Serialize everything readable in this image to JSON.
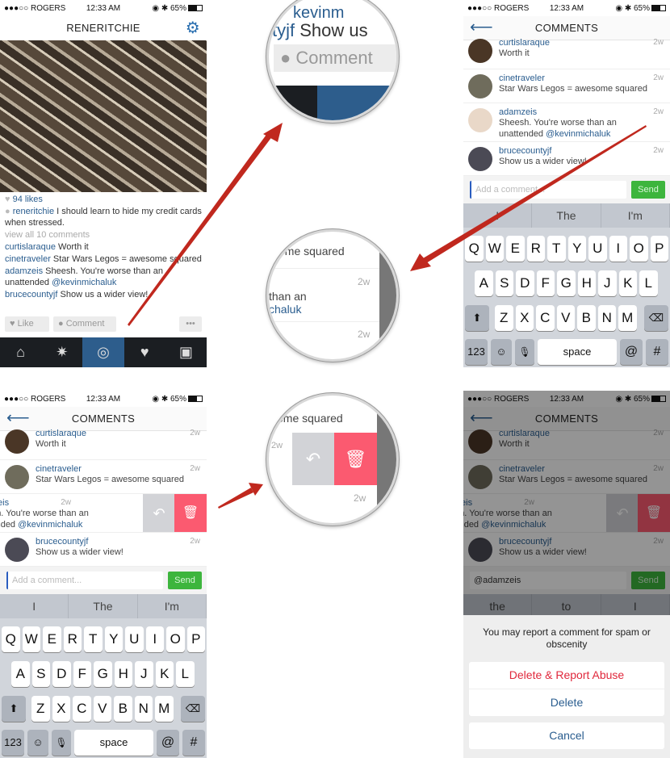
{
  "status": {
    "carrier": "●●●○○ ROGERS",
    "wifi": "≋",
    "time": "12:33 AM",
    "right": "◉ ✱ 65%"
  },
  "feed_screen": {
    "title": "RENERITCHIE",
    "likes": "94 likes",
    "caption_user": "reneritchie",
    "caption": "I should learn to hide my credit cards when stressed.",
    "view_all": "view all 10 comments",
    "comments": [
      {
        "user": "curtislaraque",
        "text": "Worth it"
      },
      {
        "user": "cinetraveler",
        "text": "Star Wars Legos = awesome squared"
      },
      {
        "user": "adamzeis",
        "text": "Sheesh. You're worse than an unattended",
        "mention": "@kevinmichaluk"
      },
      {
        "user": "brucecountyjf",
        "text": "Show us a wider view!"
      }
    ],
    "like_label": "Like",
    "comment_label": "Comment",
    "more_label": "•••"
  },
  "comments_screen": {
    "title": "COMMENTS",
    "items": [
      {
        "user": "curtislaraque",
        "text": "Worth it",
        "time": "2w"
      },
      {
        "user": "cinetraveler",
        "text": "Star Wars Legos = awesome squared",
        "time": "2w"
      },
      {
        "user": "adamzeis",
        "text": "Sheesh. You're worse than an unattended",
        "mention": "@kevinmichaluk",
        "time": "2w"
      },
      {
        "user": "brucecountyjf",
        "text": "Show us a wider view!",
        "time": "2w"
      }
    ],
    "placeholder": "Add a comment...",
    "send": "Send",
    "reply_value": "@adamzeis"
  },
  "keyboard": {
    "suggestions": [
      "I",
      "The",
      "I'm"
    ],
    "suggestions_alt": [
      "the",
      "to",
      "I"
    ],
    "row1": [
      "Q",
      "W",
      "E",
      "R",
      "T",
      "Y",
      "U",
      "I",
      "O",
      "P"
    ],
    "row2": [
      "A",
      "S",
      "D",
      "F",
      "G",
      "H",
      "J",
      "K",
      "L"
    ],
    "row3": [
      "Z",
      "X",
      "C",
      "V",
      "B",
      "N",
      "M"
    ],
    "numbers": "123",
    "emoji": "☺",
    "mic": "🎙",
    "space": "space",
    "at": "@",
    "hash": "#",
    "shift": "⬆",
    "delete": "⌫"
  },
  "action_sheet": {
    "message": "You may report a comment for spam or obscenity",
    "delete_report": "Delete & Report Abuse",
    "delete": "Delete",
    "cancel": "Cancel"
  },
  "magnifiers": {
    "top": {
      "line1": "kevinm",
      "user": "tyjf",
      "text": "Show us",
      "button": "Comment"
    },
    "middle": {
      "text1": "ome squared",
      "text2": "than an",
      "mention": "chaluk",
      "time": "2w"
    },
    "bottom": {
      "text1": "ome squared",
      "time": "2w"
    }
  },
  "colors": {
    "link": "#2a5d8f",
    "delete": "#fb5a70",
    "send": "#3db53d",
    "arrow": "#c0281e",
    "danger": "#e0283c"
  }
}
